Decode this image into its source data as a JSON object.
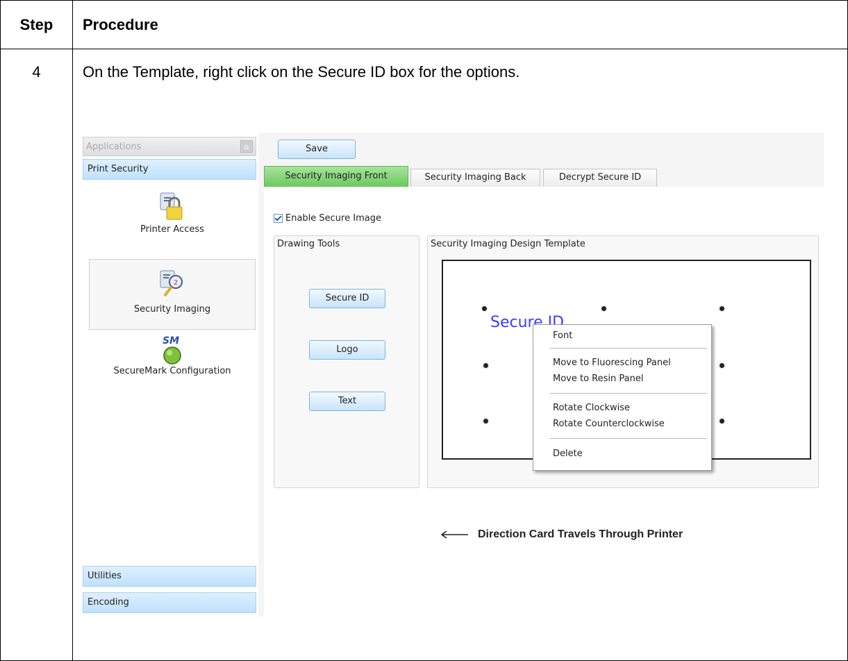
{
  "table": {
    "header_step": "Step",
    "header_procedure": "Procedure",
    "step_number": "4",
    "instruction": "On the Template, right click on the Secure ID box for the options."
  },
  "screenshot": {
    "sidebar": {
      "header": "Applications",
      "group_print_security": "Print Security",
      "items": [
        {
          "label": "Printer Access",
          "icon": "padlock-icon"
        },
        {
          "label": "Security Imaging",
          "icon": "security-imaging-icon"
        },
        {
          "label": "SecureMark Configuration",
          "icon": "securemark-icon",
          "icon_text": "SM"
        }
      ],
      "group_utilities": "Utilities",
      "group_encoding": "Encoding"
    },
    "save_button": "Save",
    "tabs": [
      {
        "label": "Security Imaging Front",
        "active": true
      },
      {
        "label": "Security Imaging Back",
        "active": false
      },
      {
        "label": "Decrypt Secure ID",
        "active": false
      }
    ],
    "enable_checkbox_label": "Enable Secure Image",
    "enable_checked": true,
    "drawing_tools": {
      "title": "Drawing Tools",
      "buttons": [
        "Secure ID",
        "Logo",
        "Text"
      ]
    },
    "design_template": {
      "title": "Security Imaging Design Template",
      "element_text": "Secure ID"
    },
    "context_menu": {
      "items": [
        "Font",
        "Move to Fluorescing Panel",
        "Move to Resin Panel",
        "Rotate Clockwise",
        "Rotate Counterclockwise",
        "Delete"
      ]
    },
    "direction_caption": "Direction Card Travels Through Printer",
    "colors": {
      "active_tab": "#6cc85e",
      "button_blue": "#c8e4fa",
      "secure_text": "#3c3cff"
    }
  }
}
